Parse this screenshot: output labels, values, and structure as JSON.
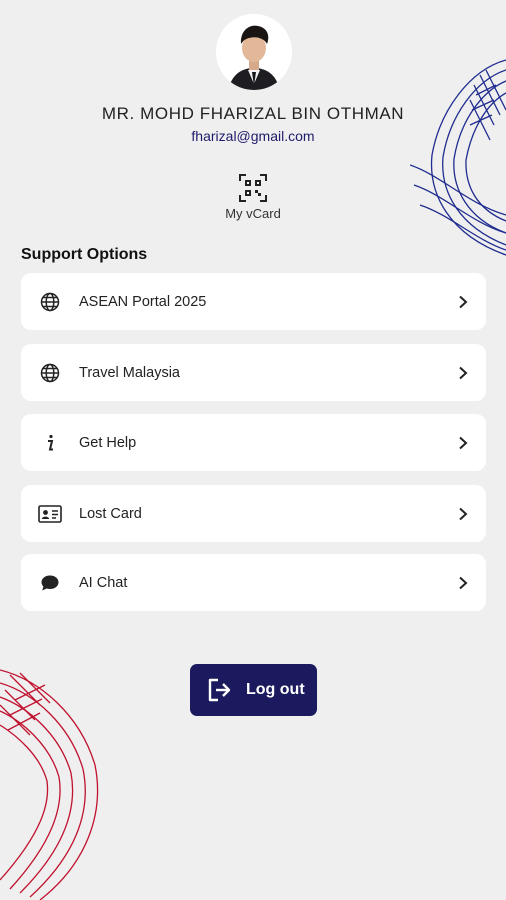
{
  "profile": {
    "name": "MR. MOHD FHARIZAL BIN OTHMAN",
    "email": "fharizal@gmail.com",
    "vcard_label": "My vCard"
  },
  "support": {
    "title": "Support Options",
    "items": [
      {
        "label": "ASEAN Portal 2025",
        "icon": "globe-icon"
      },
      {
        "label": "Travel Malaysia",
        "icon": "globe-icon"
      },
      {
        "label": "Get Help",
        "icon": "info-icon"
      },
      {
        "label": "Lost Card",
        "icon": "id-card-icon"
      },
      {
        "label": "AI Chat",
        "icon": "chat-bubble-icon"
      }
    ]
  },
  "logout": {
    "label": "Log out",
    "icon": "logout-icon"
  },
  "colors": {
    "background": "#efefef",
    "card": "#ffffff",
    "primary_navy": "#1c1a5e",
    "email_text": "#1f1b6b",
    "deco_blue": "#1f2c8f",
    "deco_red": "#c0122f"
  }
}
